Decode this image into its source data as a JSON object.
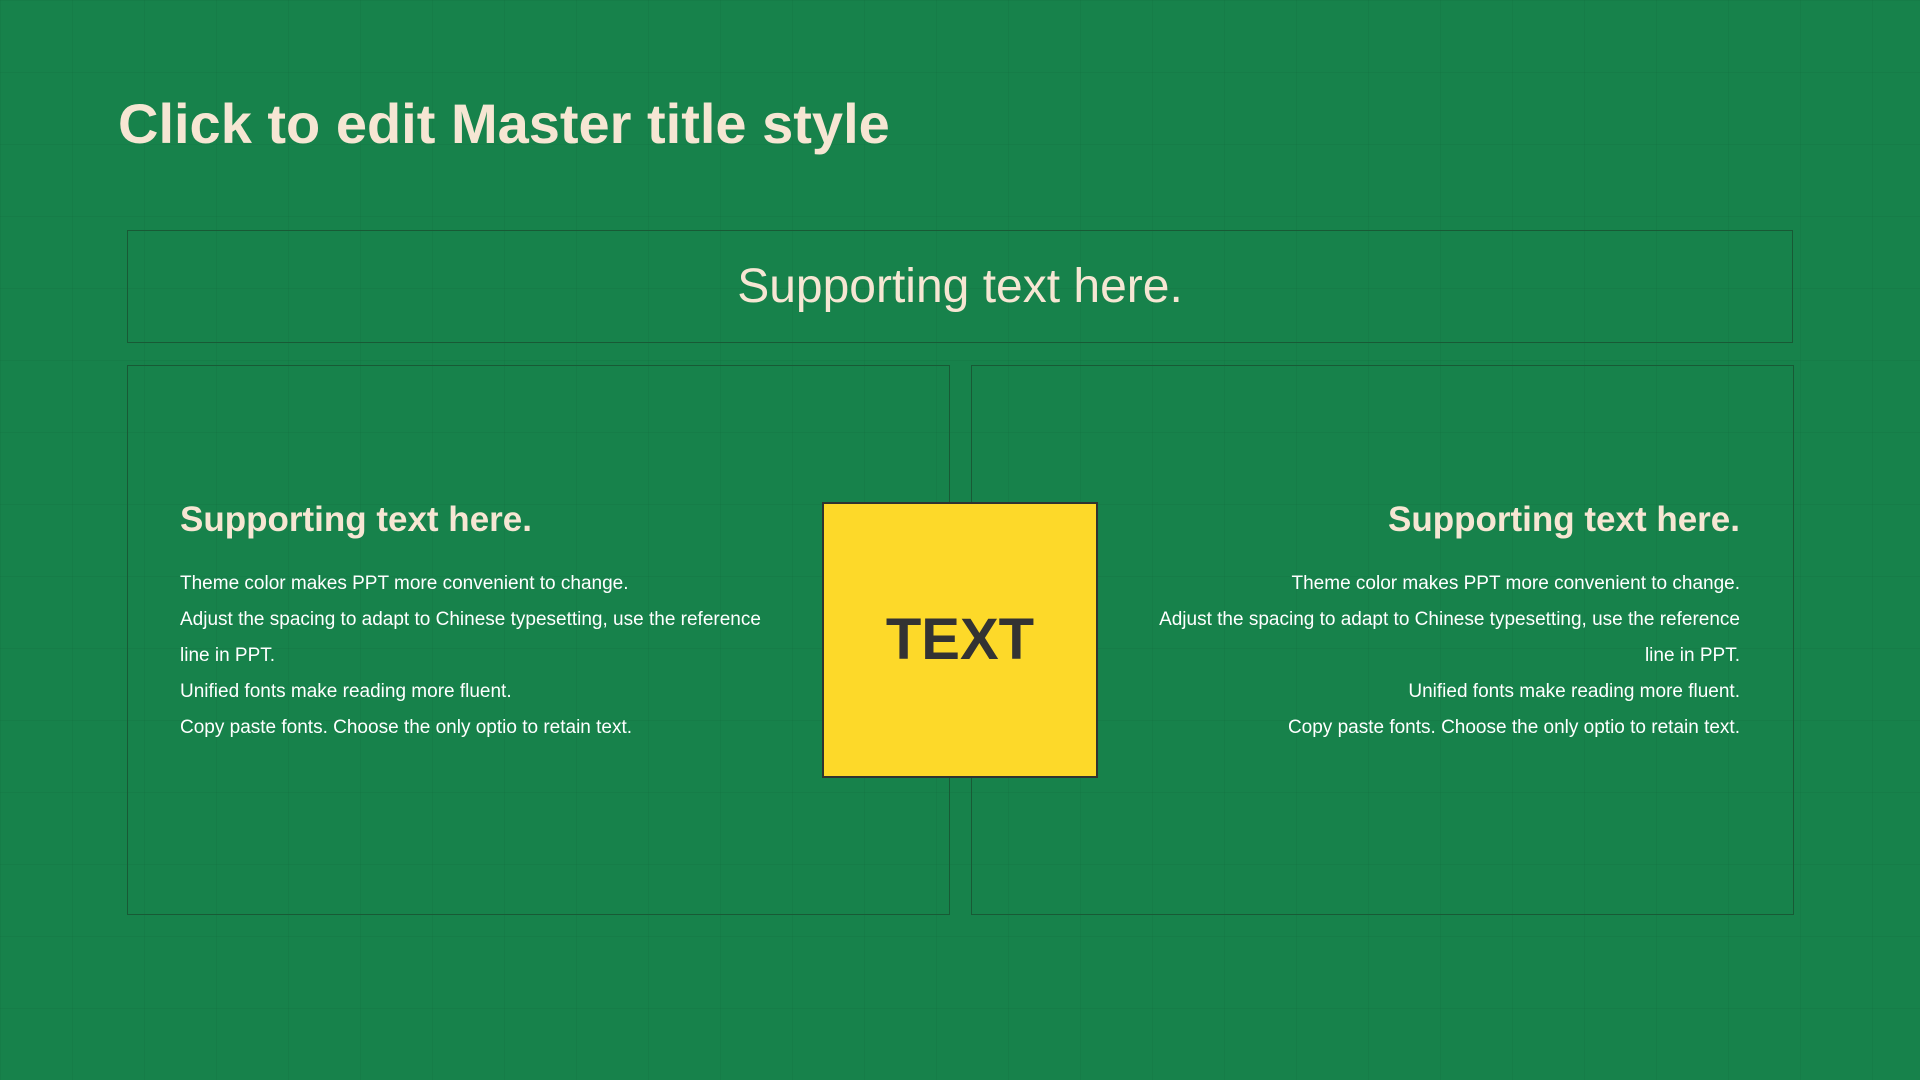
{
  "slide": {
    "title": "Click to edit Master title style",
    "banner_text": "Supporting text here.",
    "center_label": "TEXT",
    "colors": {
      "background": "#17824b",
      "title_text": "#f6e6d3",
      "body_text": "#ffffff",
      "frame_border": "#185a35",
      "center_box_fill": "#fdd929",
      "center_box_text": "#333333"
    },
    "left_block": {
      "heading": "Supporting text here.",
      "lines": [
        "Theme color makes PPT more convenient to change.",
        "Adjust the spacing to adapt to Chinese typesetting, use the reference line in PPT.",
        "Unified fonts make reading more fluent.",
        "Copy paste fonts. Choose the only optio to retain text."
      ]
    },
    "right_block": {
      "heading": "Supporting text here.",
      "lines": [
        "Theme color makes PPT more convenient to change.",
        "Adjust the spacing to adapt to Chinese typesetting, use the reference line in PPT.",
        "Unified fonts make reading more fluent.",
        "Copy paste fonts. Choose the only optio to retain text."
      ]
    }
  }
}
